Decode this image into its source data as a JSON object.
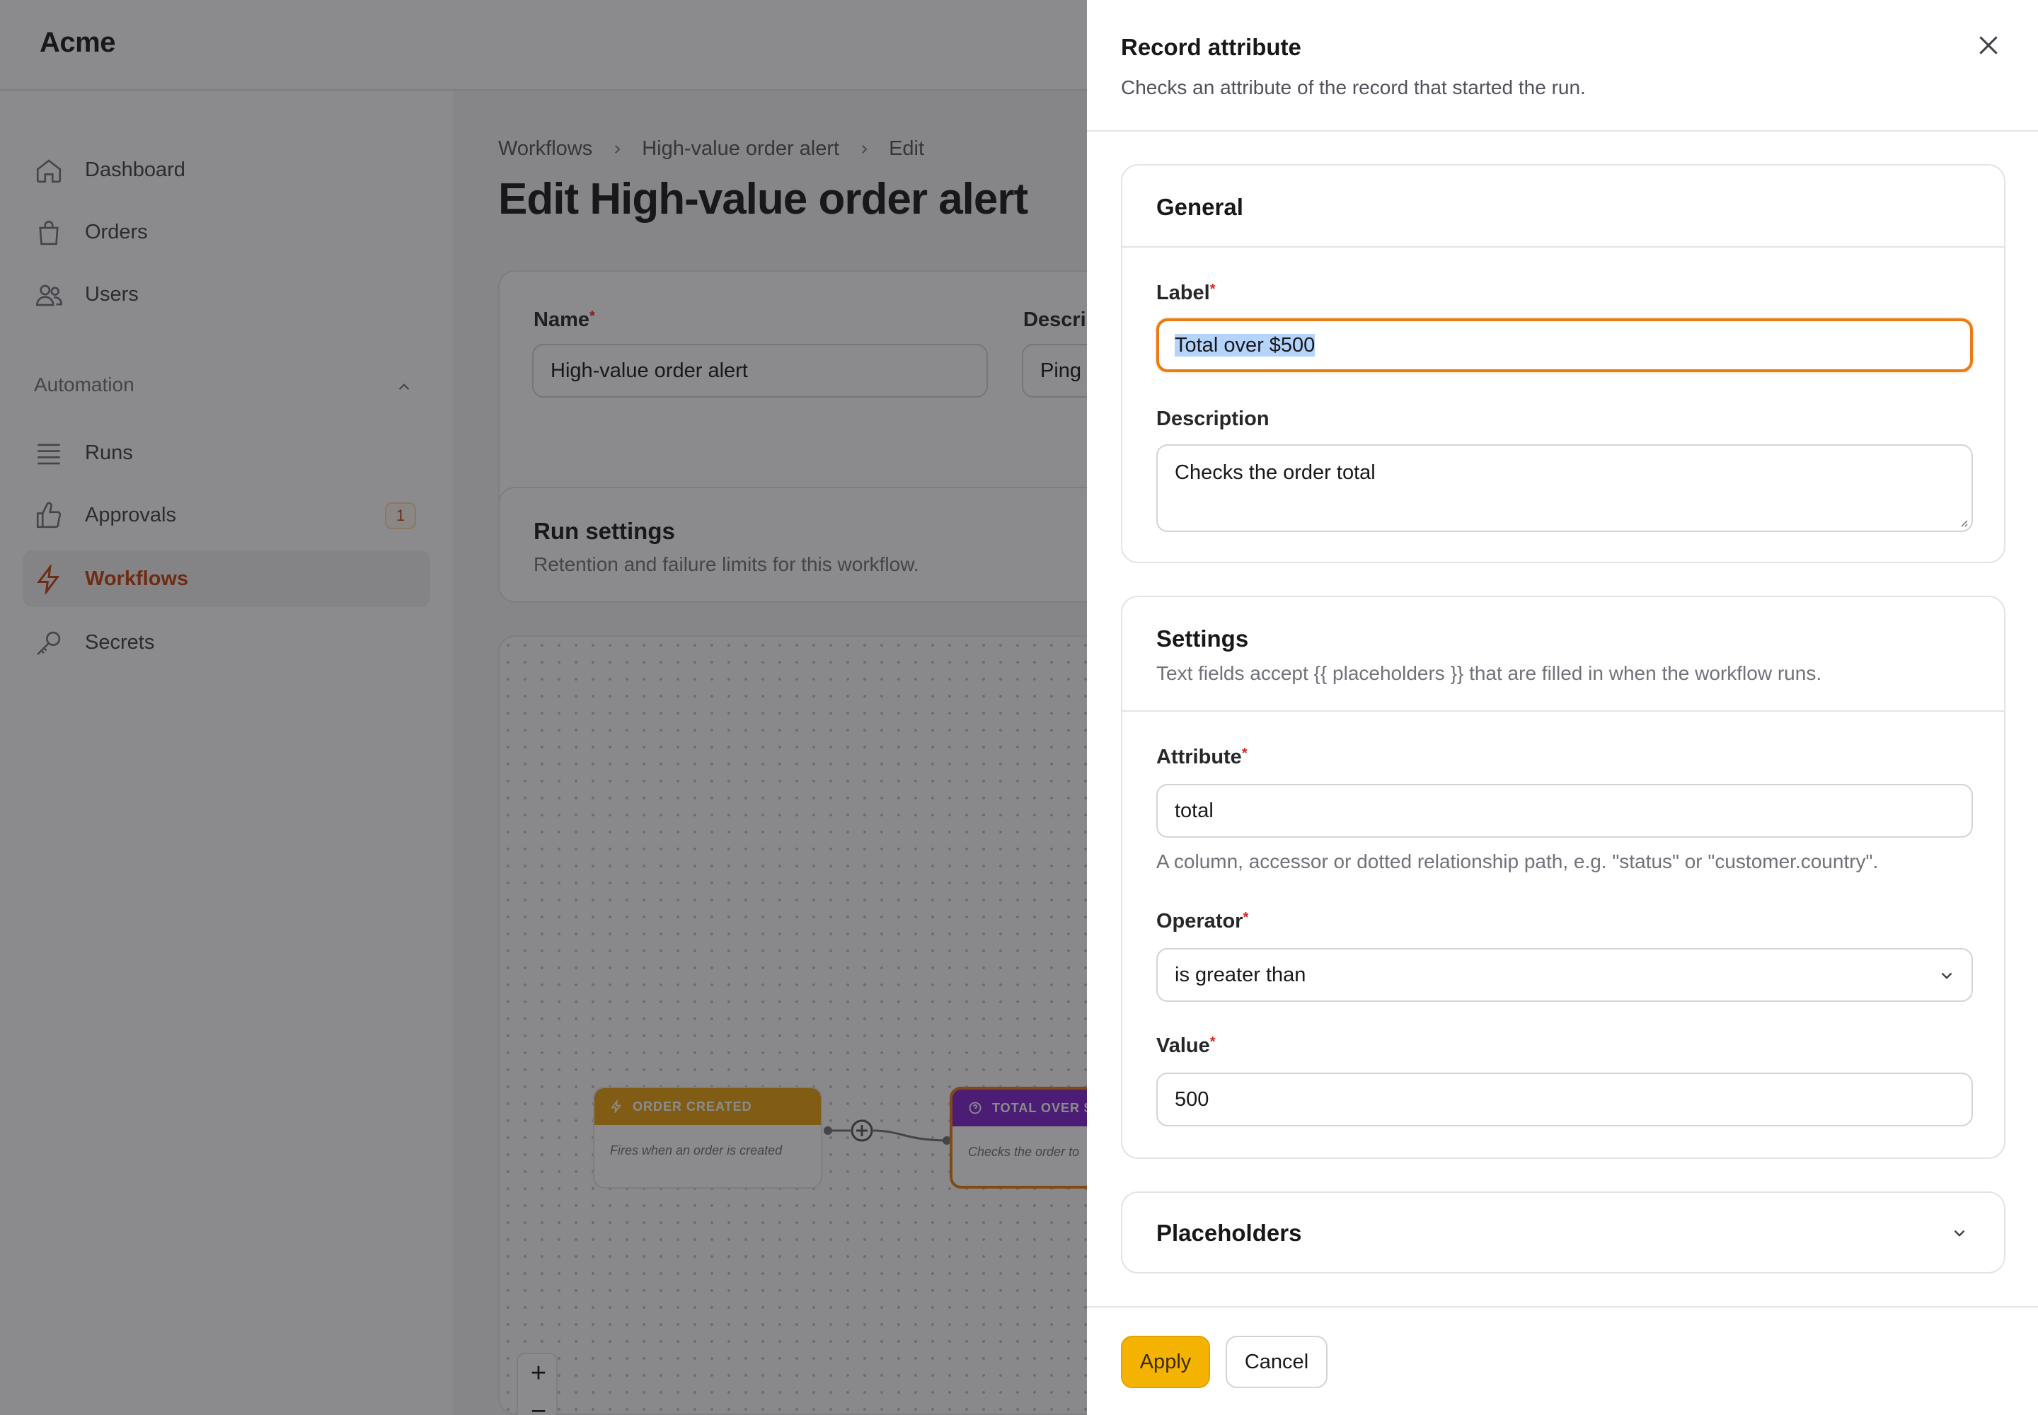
{
  "app": {
    "brand": "Acme"
  },
  "sidebar": {
    "items": [
      {
        "label": "Dashboard",
        "icon": "home-icon"
      },
      {
        "label": "Orders",
        "icon": "shopping-bag-icon"
      },
      {
        "label": "Users",
        "icon": "users-icon"
      }
    ],
    "group": {
      "label": "Automation",
      "items": [
        {
          "label": "Runs",
          "icon": "list-icon"
        },
        {
          "label": "Approvals",
          "icon": "thumbs-up-icon",
          "badge": "1"
        },
        {
          "label": "Workflows",
          "icon": "bolt-icon",
          "active": true
        },
        {
          "label": "Secrets",
          "icon": "key-icon"
        }
      ]
    }
  },
  "breadcrumb": [
    "Workflows",
    "High-value order alert",
    "Edit"
  ],
  "page": {
    "title": "Edit High-value order alert",
    "name_label": "Name",
    "name_value": "High-value order alert",
    "description_label": "Descrip",
    "description_value": "Ping t",
    "run_settings_title": "Run settings",
    "run_settings_desc": "Retention and failure limits for this workflow."
  },
  "canvas": {
    "nodes": [
      {
        "header": "ORDER CREATED",
        "body": "Fires when an order is created",
        "color": "#e8a10c"
      },
      {
        "header": "TOTAL OVER $",
        "body": "Checks the order to",
        "color": "#7e22ce"
      }
    ],
    "zoom_in": "+",
    "zoom_out": "−"
  },
  "drawer": {
    "title": "Record attribute",
    "subtitle": "Checks an attribute of the record that started the run.",
    "general": {
      "title": "General",
      "label_label": "Label",
      "label_value": "Total over $500",
      "description_label": "Description",
      "description_value": "Checks the order total"
    },
    "settings": {
      "title": "Settings",
      "description": "Text fields accept {{ placeholders }} that are filled in when the workflow runs.",
      "attribute_label": "Attribute",
      "attribute_value": "total",
      "attribute_hint": "A column, accessor or dotted relationship path, e.g. \"status\" or \"customer.country\".",
      "operator_label": "Operator",
      "operator_value": "is greater than",
      "value_label": "Value",
      "value_value": "500"
    },
    "placeholders": {
      "title": "Placeholders"
    },
    "footer": {
      "apply": "Apply",
      "cancel": "Cancel"
    }
  },
  "colors": {
    "accent": "#ea7a12",
    "apply_button": "#f5b301",
    "required": "#dc2626"
  }
}
